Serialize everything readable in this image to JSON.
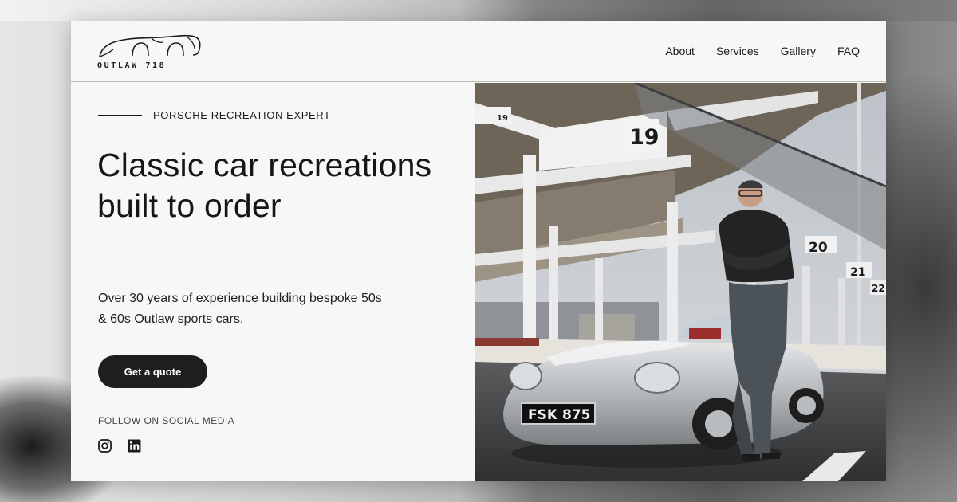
{
  "brand": {
    "logo_text": "OUTLAW 718"
  },
  "nav": {
    "items": [
      "About",
      "Services",
      "Gallery",
      "FAQ"
    ]
  },
  "hero": {
    "eyebrow": "PORSCHE RECREATION EXPERT",
    "headline": "Classic car recreations built to order",
    "subtext": "Over 30 years of experience building bespoke 50s & 60s Outlaw sports cars.",
    "cta_label": "Get a quote",
    "social_heading": "FOLLOW ON SOCIAL MEDIA",
    "social_icons": [
      "instagram-icon",
      "linkedin-icon"
    ]
  },
  "photo": {
    "pit_numbers": [
      "19",
      "19",
      "20",
      "21",
      "22"
    ],
    "license_plate": "FSK 875"
  },
  "colors": {
    "text": "#1c1c1c",
    "button_bg": "#1e1e1e",
    "button_text": "#ffffff",
    "page_bg": "#f7f7f7"
  }
}
